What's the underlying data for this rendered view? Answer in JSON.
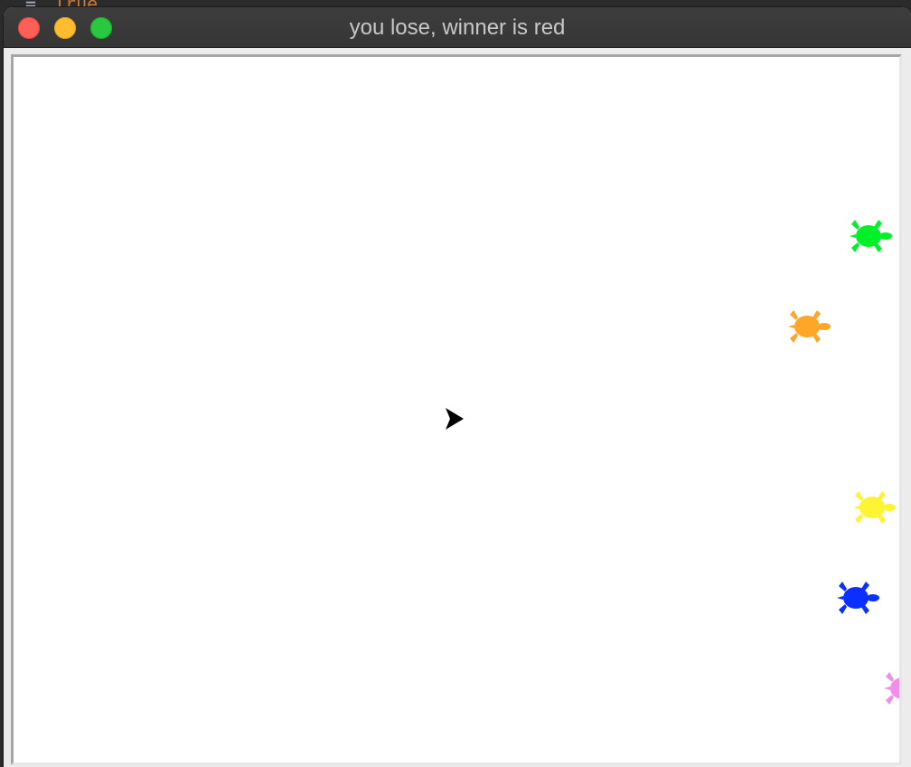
{
  "window": {
    "title": "you lose, winner is red"
  },
  "backdrop": {
    "code_fragment": "True"
  },
  "canvas": {
    "background": "#ffffff",
    "cursor_icon": "arrow-cursor-icon",
    "turtles": [
      {
        "name": "green-turtle",
        "color": "#00f029"
      },
      {
        "name": "orange-turtle",
        "color": "#ffa528"
      },
      {
        "name": "yellow-turtle",
        "color": "#fff433"
      },
      {
        "name": "blue-turtle",
        "color": "#0b2fff"
      },
      {
        "name": "pink-turtle",
        "color": "#ee90e9"
      }
    ]
  }
}
